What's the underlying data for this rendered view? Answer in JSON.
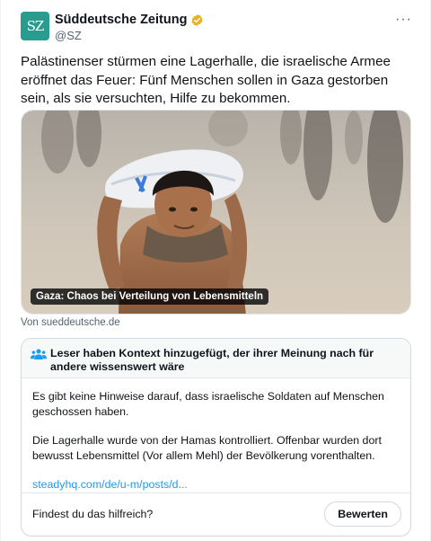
{
  "post": {
    "author": {
      "name": "Süddeutsche Zeitung",
      "handle": "@SZ",
      "avatar_text": "SZ",
      "avatar_color": "#2a9c8f",
      "verified_color": "#e8b226"
    },
    "more_icon": "more-horizontal-icon",
    "more_label": "···",
    "text": "Palästinenser stürmen eine Lagerhalle, die israelische Armee eröffnet das Feuer: Fünf Menschen sollen in Gaza gestorben sein, als sie versuchten, Hilfe zu bekommen.",
    "media": {
      "caption": "Gaza: Chaos bei Verteilung von Lebensmitteln"
    },
    "source": "Von sueddeutsche.de"
  },
  "community_note": {
    "icon": "people-group-icon",
    "title": "Leser haben Kontext hinzugefügt, der ihrer Meinung nach für andere wissenswert wäre",
    "paragraph_1": "Es gibt keine Hinweise darauf, dass israelische Soldaten auf Menschen geschossen haben.",
    "paragraph_2": "Die Lagerhalle wurde von der Hamas kontrolliert. Offenbar wurden dort bewusst Lebensmittel (Vor allem Mehl) der Bevölkerung vorenthalten.",
    "link": "steadyhq.com/de/u-m/posts/d...",
    "question": "Findest du das hilfreich?",
    "rate_button": "Bewerten",
    "link_color": "#1d9bf0"
  }
}
